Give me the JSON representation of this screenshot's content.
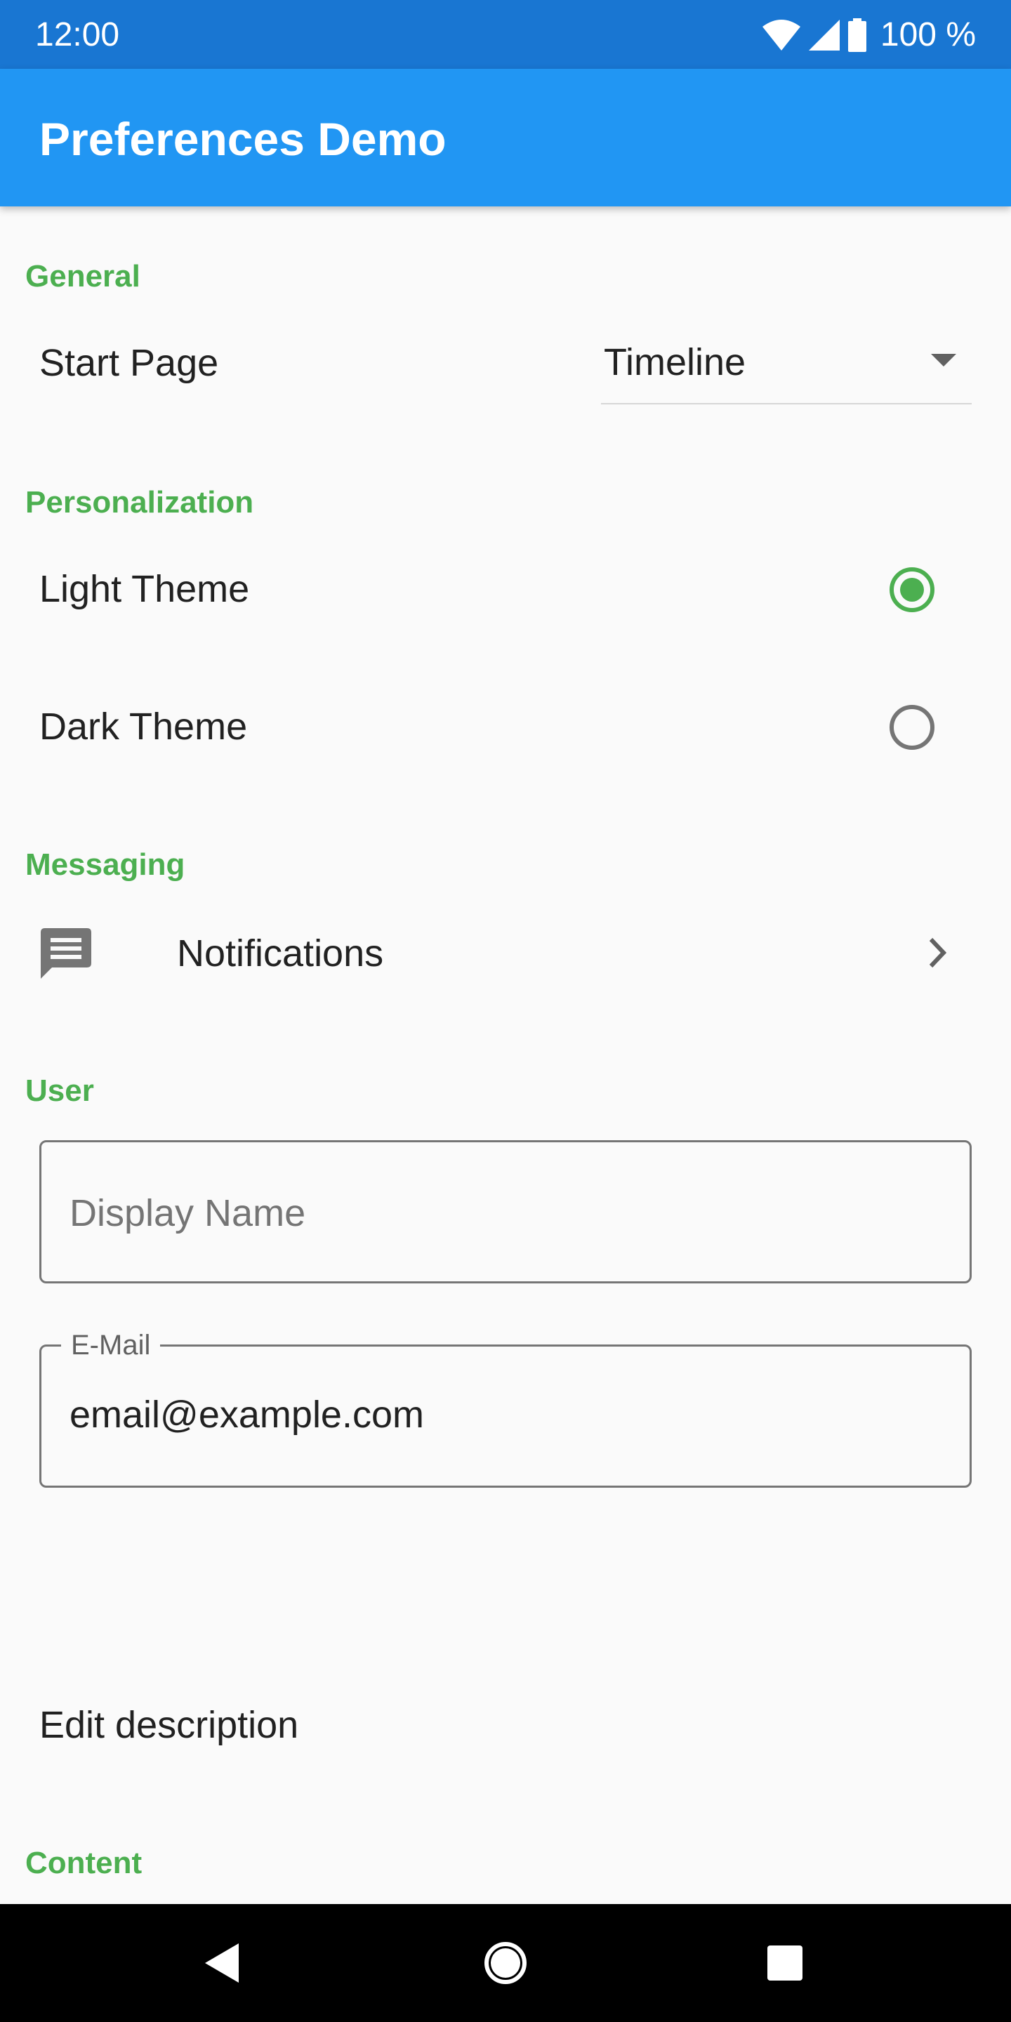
{
  "status_bar": {
    "time": "12:00",
    "battery_text": "100 %",
    "icons": [
      "wifi-icon",
      "cell-signal-icon",
      "battery-icon"
    ]
  },
  "app_bar": {
    "title": "Preferences Demo"
  },
  "sections": {
    "general": {
      "header": "General",
      "start_page": {
        "label": "Start Page",
        "value": "Timeline"
      }
    },
    "personalization": {
      "header": "Personalization",
      "light_theme": {
        "label": "Light Theme",
        "selected": true
      },
      "dark_theme": {
        "label": "Dark Theme",
        "selected": false
      }
    },
    "messaging": {
      "header": "Messaging",
      "notifications": {
        "label": "Notifications",
        "icon": "message-icon"
      }
    },
    "user": {
      "header": "User",
      "display_name": {
        "placeholder": "Display Name",
        "value": ""
      },
      "email": {
        "label": "E-Mail",
        "value": "email@example.com"
      },
      "edit_description": {
        "label": "Edit description"
      }
    },
    "content": {
      "header": "Content"
    }
  },
  "nav_bar": {
    "icons": [
      "back-icon",
      "home-icon",
      "recents-icon"
    ]
  },
  "colors": {
    "status_bar": "#1976d2",
    "app_bar": "#2196f3",
    "accent": "#4caf50",
    "background": "#fafafa"
  }
}
